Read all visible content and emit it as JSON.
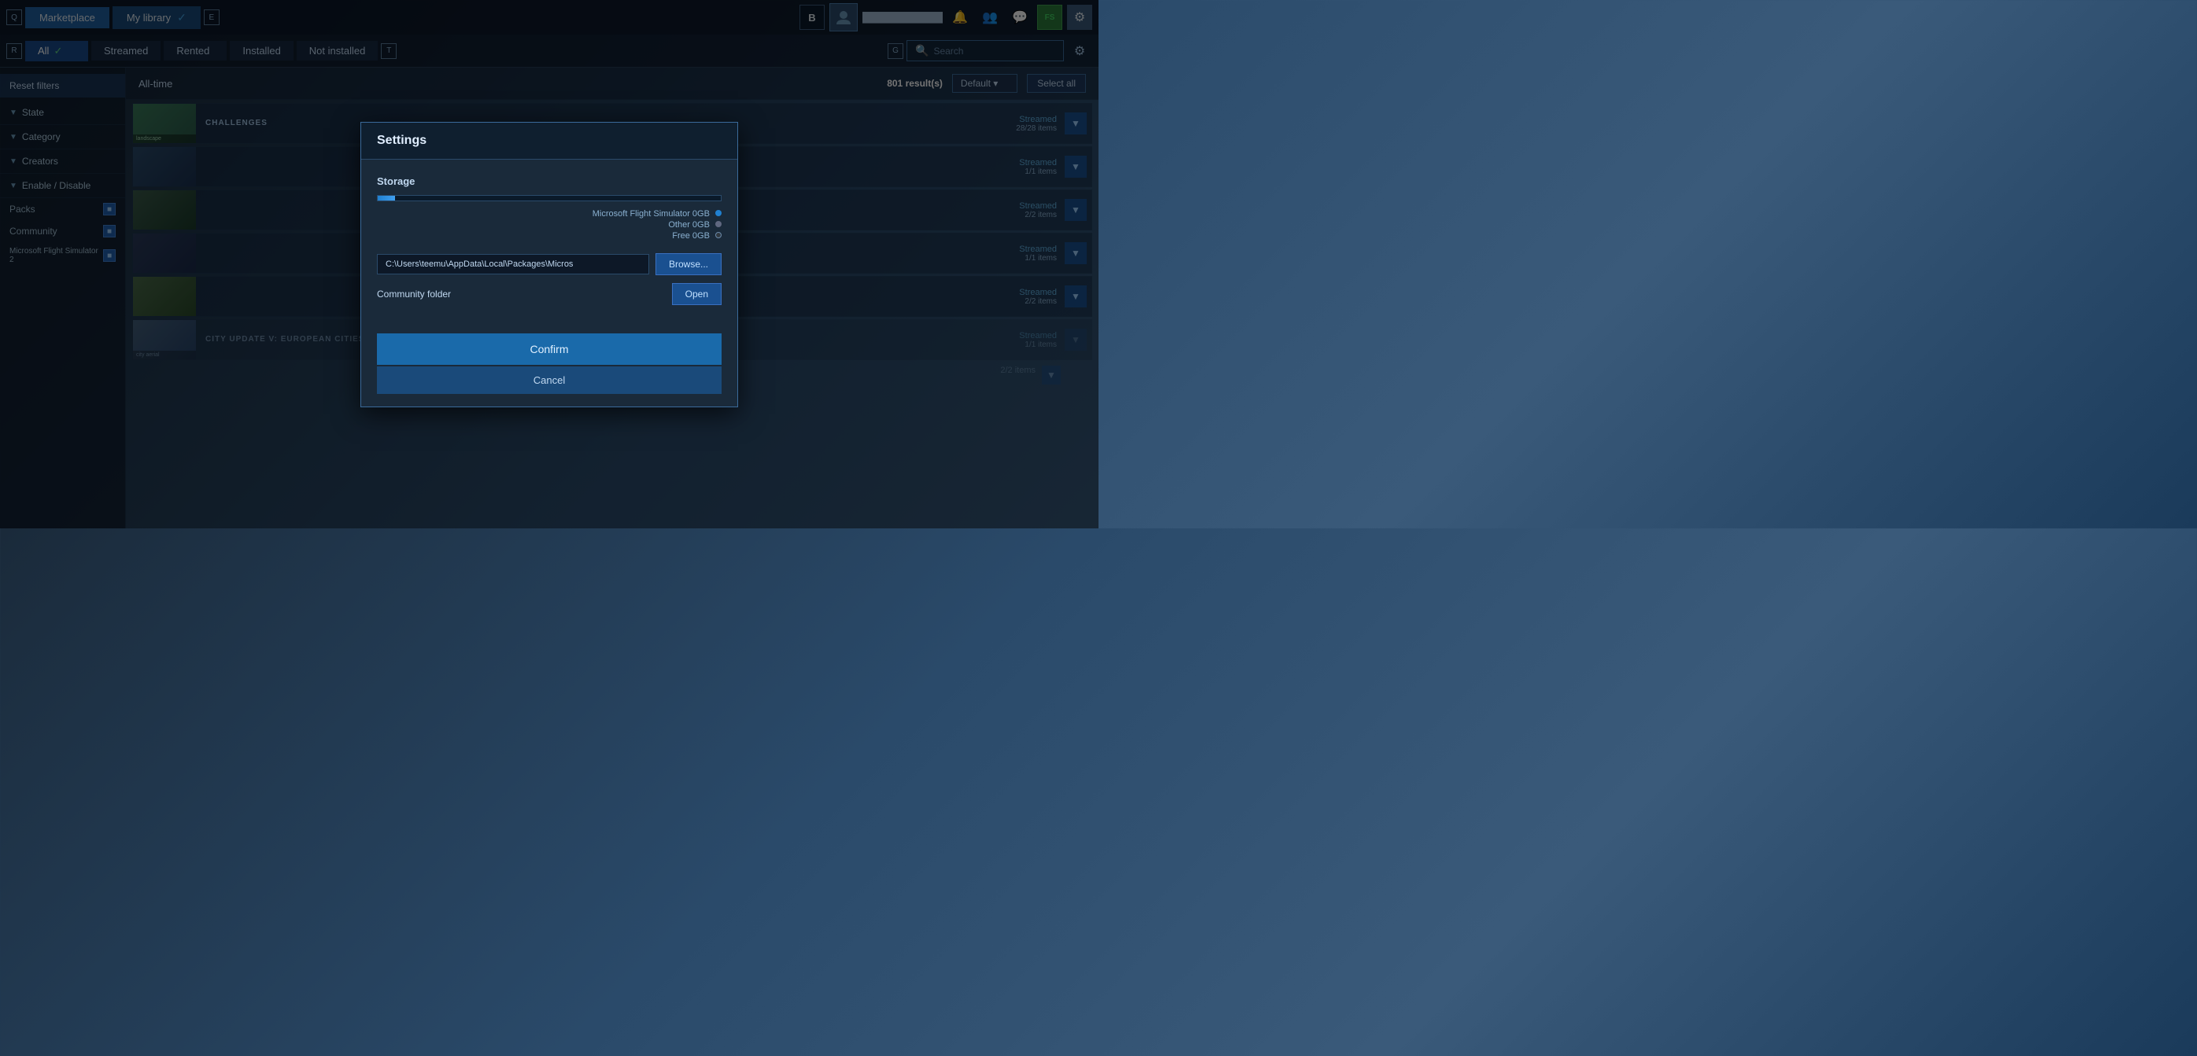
{
  "topNav": {
    "key_q": "Q",
    "key_e": "E",
    "marketplace_label": "Marketplace",
    "my_library_label": "My library",
    "key_b": "B",
    "username": "████████████",
    "nav_fs_label": "FS",
    "gear_label": "⚙"
  },
  "filterBar": {
    "key_r": "R",
    "key_t": "T",
    "key_g": "G",
    "tabs": [
      {
        "id": "all",
        "label": "All",
        "active": true
      },
      {
        "id": "streamed",
        "label": "Streamed",
        "active": false
      },
      {
        "id": "rented",
        "label": "Rented",
        "active": false
      },
      {
        "id": "installed",
        "label": "Installed",
        "active": false
      },
      {
        "id": "not-installed",
        "label": "Not installed",
        "active": false
      }
    ],
    "search_placeholder": "Search"
  },
  "sidebar": {
    "reset_filters": "Reset filters",
    "filters": [
      {
        "id": "state",
        "label": "State"
      },
      {
        "id": "category",
        "label": "Category"
      },
      {
        "id": "creators",
        "label": "Creators"
      },
      {
        "id": "enable-disable",
        "label": "Enable / Disable"
      }
    ],
    "items": [
      {
        "id": "packs",
        "label": "Packs",
        "checked": true
      },
      {
        "id": "community",
        "label": "Community",
        "checked": true
      },
      {
        "id": "ms-fs2",
        "label": "Microsoft Flight Simulator 2",
        "checked": true
      }
    ]
  },
  "content": {
    "all_time_label": "All-time",
    "results_count": "801",
    "results_label": "result(s)",
    "sort_label": "Default",
    "select_all": "Select all",
    "items": [
      {
        "id": "item1",
        "label": "CHALLENGES",
        "streamed_label": "Streamed",
        "streamed_count": "28/28 items",
        "has_thumb": true,
        "thumb_color": "#3a7a5a"
      },
      {
        "id": "item2",
        "label": "",
        "streamed_label": "Streamed",
        "streamed_count": "1/1 items",
        "has_thumb": false
      },
      {
        "id": "item3",
        "label": "",
        "streamed_label": "Streamed",
        "streamed_count": "2/2 items",
        "has_thumb": false
      },
      {
        "id": "item4",
        "label": "",
        "streamed_label": "Streamed",
        "streamed_count": "1/1 items",
        "has_thumb": false
      },
      {
        "id": "item5",
        "label": "",
        "streamed_label": "Streamed",
        "streamed_count": "2/2 items",
        "has_thumb": false
      }
    ],
    "bottom_items": [
      {
        "id": "city-update",
        "label": "CITY UPDATE V: EUROPEAN CITIES I",
        "streamed_label": "Streamed",
        "streamed_count": "1/1 items"
      }
    ],
    "last_item_count": "2/2 items"
  },
  "modal": {
    "title": "Settings",
    "storage_label": "Storage",
    "ms_fs_label": "Microsoft Flight Simulator",
    "ms_fs_size": "0GB",
    "other_label": "Other",
    "other_size": "0GB",
    "free_label": "Free",
    "free_size": "0GB",
    "path_value": "C:\\Users\\teemu\\AppData\\Local\\Packages\\Micros",
    "browse_label": "Browse...",
    "community_folder_label": "Community folder",
    "open_label": "Open",
    "confirm_label": "Confirm",
    "cancel_label": "Cancel"
  }
}
